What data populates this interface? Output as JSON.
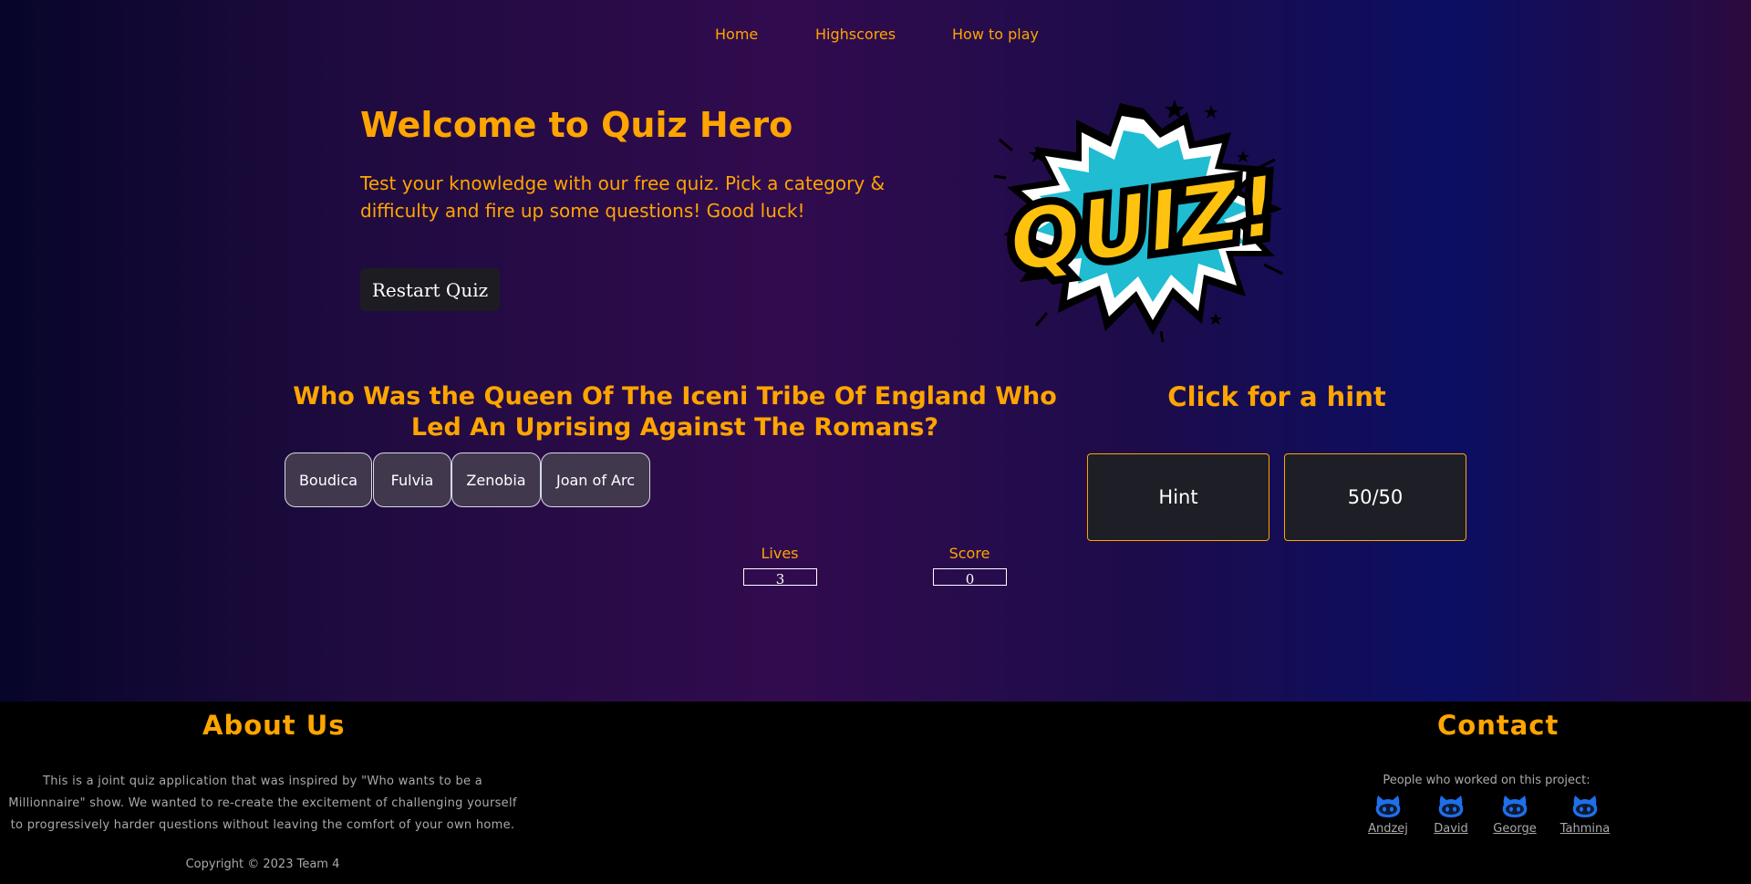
{
  "nav": {
    "home": "Home",
    "highscores": "Highscores",
    "how_to_play": "How to play"
  },
  "hero": {
    "title": "Welcome to Quiz Hero",
    "subtitle": "Test your knowledge with our free quiz. Pick a category & difficulty and fire up some questions! Good luck!",
    "restart_label": "Restart Quiz",
    "logo_text": "QUIZ!"
  },
  "quiz": {
    "question": "Who Was the Queen Of The Iceni Tribe Of England Who Led An Uprising Against The Romans?",
    "answers": [
      "Boudica",
      "Fulvia",
      "Zenobia",
      "Joan of Arc"
    ],
    "lives_label": "Lives",
    "lives_value": "3",
    "score_label": "Score",
    "score_value": "0"
  },
  "hints": {
    "title": "Click for a hint",
    "hint_label": "Hint",
    "fifty_label": "50/50"
  },
  "footer": {
    "about_title": "About Us",
    "about_text": "This is a joint quiz application that was inspired by \"Who wants to be a Millionnaire\" show. We wanted to re-create the excitement of challenging yourself to progressively harder questions without leaving the comfort of your own home.",
    "copyright": "Copyright © 2023 Team 4",
    "contact_title": "Contact",
    "people_label": "People who worked on this project:",
    "people": [
      "Andzej",
      "David",
      "George",
      "Tahmina"
    ]
  },
  "colors": {
    "accent": "#ffa500",
    "answer_bg": "#41384e",
    "hint_bg": "#1e1e26",
    "github_icon": "#1f6feb",
    "logo_yellow": "#ffc20e",
    "logo_cyan": "#1fbcd2"
  },
  "icons": {
    "contact": "github-octocat-icon"
  }
}
